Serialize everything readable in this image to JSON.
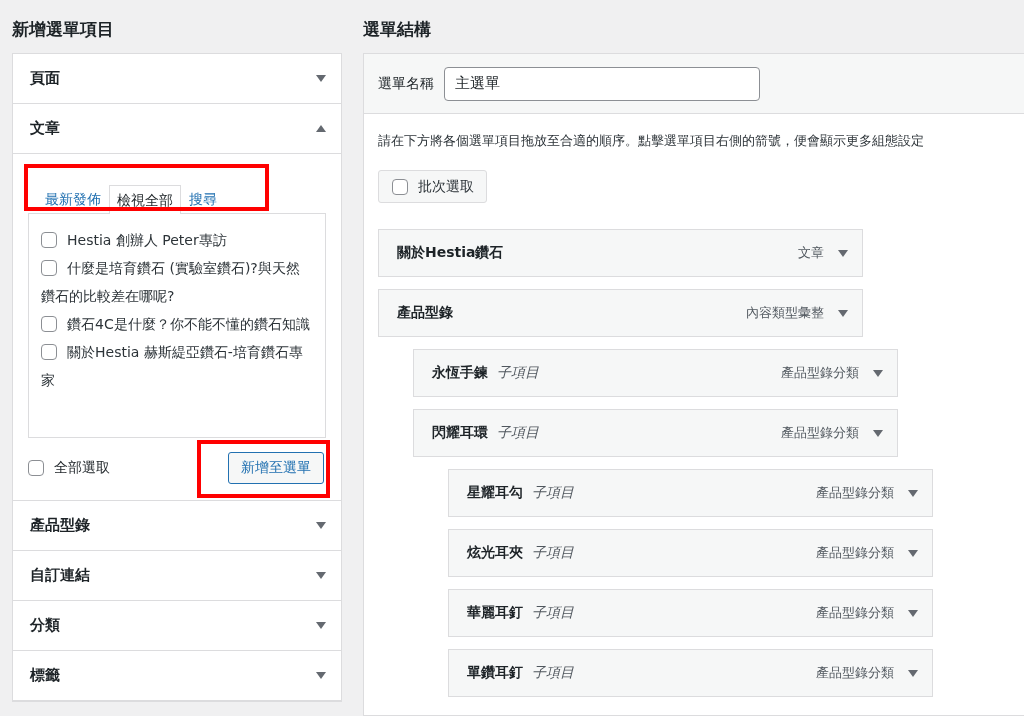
{
  "add_items": {
    "title": "新增選單項目",
    "sections": [
      {
        "title": "頁面",
        "expanded": false
      },
      {
        "title": "文章",
        "expanded": true,
        "highlight_tabs": true,
        "tabs": [
          {
            "label": "最新發佈",
            "selected": false
          },
          {
            "label": "檢視全部",
            "selected": true
          },
          {
            "label": "搜尋",
            "selected": false
          }
        ],
        "posts": [
          {
            "label": "Hestia 創辦人 Peter專訪",
            "checked": false
          },
          {
            "label": "什麼是培育鑽石 (實驗室鑽石)?與天然鑽石的比較差在哪呢?",
            "checked": false
          },
          {
            "label": "鑽石4C是什麼？你不能不懂的鑽石知識",
            "checked": false
          },
          {
            "label": "關於Hestia 赫斯緹亞鑽石-培育鑽石專家",
            "checked": false
          }
        ],
        "select_all": {
          "label": "全部選取",
          "checked": false
        },
        "add_button": {
          "label": "新增至選單",
          "highlight": true
        }
      },
      {
        "title": "產品型錄",
        "expanded": false
      },
      {
        "title": "自訂連結",
        "expanded": false
      },
      {
        "title": "分類",
        "expanded": false
      },
      {
        "title": "標籤",
        "expanded": false
      }
    ]
  },
  "menu_structure": {
    "title": "選單結構",
    "name_label": "選單名稱",
    "name_value": "主選單",
    "instructions": "請在下方將各個選單項目拖放至合適的順序。點擊選單項目右側的箭號，便會顯示更多組態設定",
    "bulk_select": {
      "label": "批次選取",
      "checked": false
    },
    "items": [
      {
        "title": "關於Hestia鑽石",
        "type": "文章"
      },
      {
        "title": "產品型錄",
        "type": "內容類型彙整",
        "children": [
          {
            "title": "永恆手鍊",
            "sublabel": "子項目",
            "type": "產品型錄分類"
          },
          {
            "title": "閃耀耳環",
            "sublabel": "子項目",
            "type": "產品型錄分類",
            "children": [
              {
                "title": "星耀耳勾",
                "sublabel": "子項目",
                "type": "產品型錄分類"
              },
              {
                "title": "炫光耳夾",
                "sublabel": "子項目",
                "type": "產品型錄分類"
              },
              {
                "title": "華麗耳釘",
                "sublabel": "子項目",
                "type": "產品型錄分類"
              },
              {
                "title": "單鑽耳釘",
                "sublabel": "子項目",
                "type": "產品型錄分類"
              }
            ]
          }
        ]
      }
    ]
  }
}
